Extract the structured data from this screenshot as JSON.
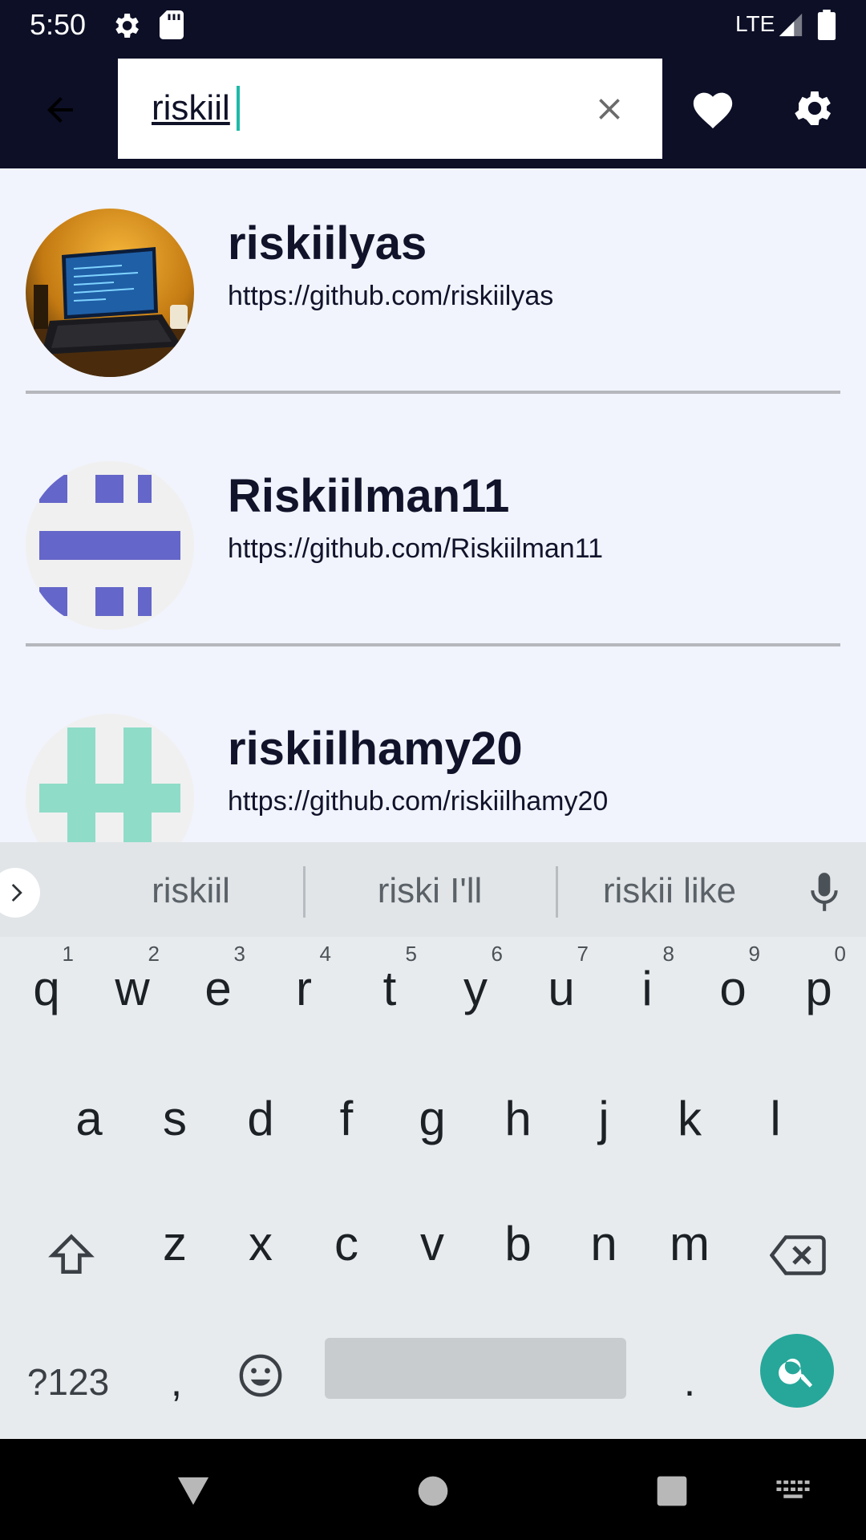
{
  "status_bar": {
    "time": "5:50",
    "network": "LTE",
    "icons": [
      "settings-icon",
      "sd-card-icon",
      "signal-icon",
      "battery-icon"
    ]
  },
  "app_bar": {
    "back_icon": "arrow-left-icon",
    "search": {
      "value": "riskiil",
      "placeholder": "",
      "clear_icon": "close-icon"
    },
    "favorite_icon": "heart-icon",
    "settings_icon": "gear-icon"
  },
  "results": [
    {
      "name": "riskiilyas",
      "url": "https://github.com/riskiilyas",
      "avatar": "photo-laptop"
    },
    {
      "name": "Riskiilman11",
      "url": "https://github.com/Riskiilman11",
      "avatar": "identicon-purple"
    },
    {
      "name": "riskiilhamy20",
      "url": "https://github.com/riskiilhamy20",
      "avatar": "identicon-teal"
    }
  ],
  "keyboard": {
    "suggestions": [
      "riskiil",
      "riski I'll",
      "riskii like"
    ],
    "row1": [
      {
        "letter": "q",
        "hint": "1"
      },
      {
        "letter": "w",
        "hint": "2"
      },
      {
        "letter": "e",
        "hint": "3"
      },
      {
        "letter": "r",
        "hint": "4"
      },
      {
        "letter": "t",
        "hint": "5"
      },
      {
        "letter": "y",
        "hint": "6"
      },
      {
        "letter": "u",
        "hint": "7"
      },
      {
        "letter": "i",
        "hint": "8"
      },
      {
        "letter": "o",
        "hint": "9"
      },
      {
        "letter": "p",
        "hint": "0"
      }
    ],
    "row2": [
      "a",
      "s",
      "d",
      "f",
      "g",
      "h",
      "j",
      "k",
      "l"
    ],
    "row3": [
      "z",
      "x",
      "c",
      "v",
      "b",
      "n",
      "m"
    ],
    "symbols_label": "?123",
    "comma": ",",
    "period": ".",
    "colors": {
      "accent": "#26a79a",
      "cursor": "#1eb9a8"
    }
  },
  "colors": {
    "app_bar": "#0c0f26",
    "background": "#f1f4fd",
    "identicon_purple": "#6466c9",
    "identicon_teal": "#8fdcc8"
  }
}
